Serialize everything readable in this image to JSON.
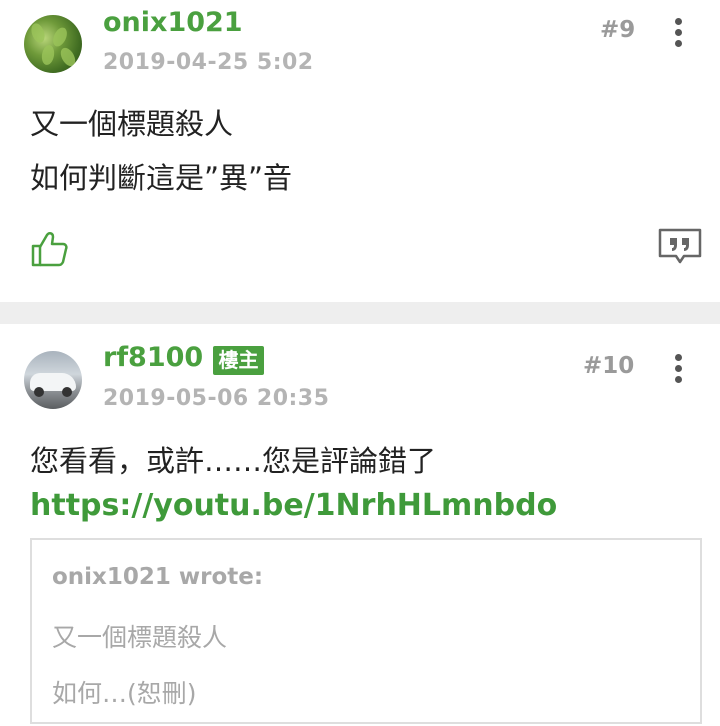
{
  "posts": [
    {
      "username": "onix1021",
      "timestamp": "2019-04-25 5:02",
      "floor": "#9",
      "lines": [
        "又一個標題殺人",
        "如何判斷這是”異”音"
      ]
    },
    {
      "username": "rf8100",
      "badge": "樓主",
      "timestamp": "2019-05-06 20:35",
      "floor": "#10",
      "lines": [
        "您看看，或許……您是評論錯了"
      ],
      "link": "https://youtu.be/1NrhHLmnbdo",
      "quote": {
        "author": "onix1021 wrote:",
        "lines": [
          "又一個標題殺人",
          "如何…(恕刪)"
        ]
      }
    }
  ],
  "icons": {
    "like": "thumbs-up-icon",
    "reply": "quote-reply-icon",
    "more": "more-vertical-icon"
  },
  "colors": {
    "accent": "#4aa03f",
    "meta": "#b4b4b4",
    "divider": "#eeeeee"
  }
}
